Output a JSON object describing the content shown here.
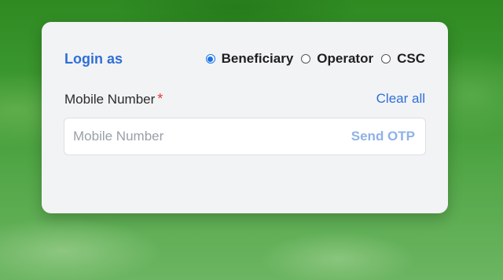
{
  "login": {
    "title": "Login as",
    "options": [
      {
        "label": "Beneficiary",
        "checked": true
      },
      {
        "label": "Operator",
        "checked": false
      },
      {
        "label": "CSC",
        "checked": false
      }
    ]
  },
  "mobile": {
    "label": "Mobile Number",
    "required_mark": "*",
    "clear_label": "Clear all",
    "placeholder": "Mobile Number",
    "value": "",
    "send_otp_label": "Send OTP"
  },
  "colors": {
    "accent": "#2f6fd6",
    "radio_checked": "#1a73e8",
    "required": "#e53935",
    "send_otp_disabled": "#8fb1e6",
    "card_bg": "#f2f3f5"
  }
}
